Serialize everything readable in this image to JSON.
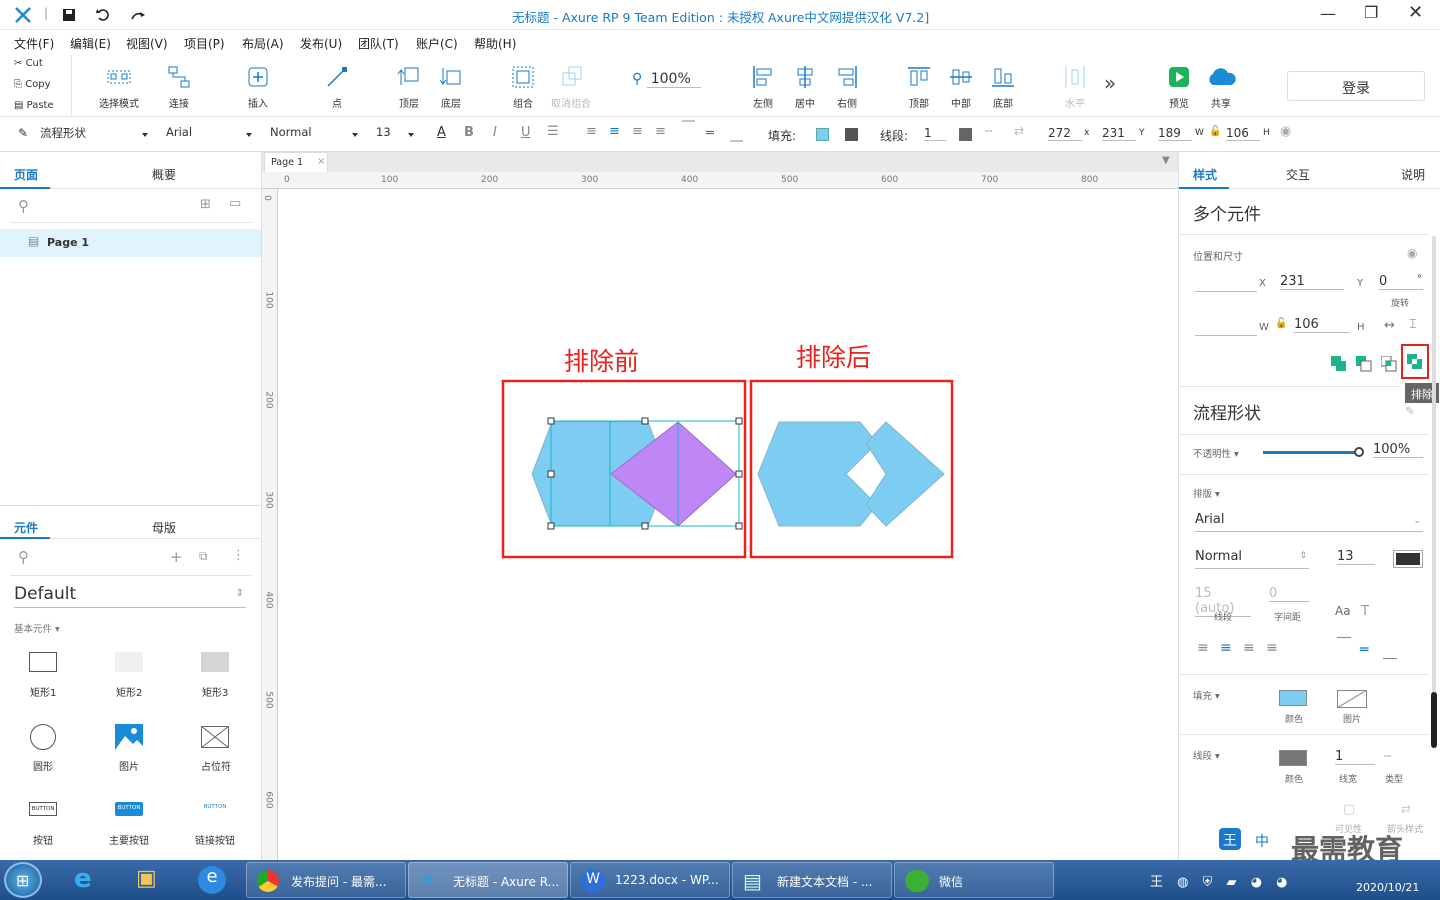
{
  "window": {
    "title": "无标题 - Axure RP 9 Team Edition : ",
    "title_status": "未授权",
    "title_extra": "Axure中文网提供汉化 V7.2]"
  },
  "menu": [
    "文件(F)",
    "编辑(E)",
    "视图(V)",
    "项目(P)",
    "布局(A)",
    "发布(U)",
    "团队(T)",
    "账户(C)",
    "帮助(H)"
  ],
  "clipboard": {
    "cut": "Cut",
    "copy": "Copy",
    "paste": "Paste"
  },
  "toolbar": {
    "select_mode": "选择模式",
    "connect": "连接",
    "insert": "插入",
    "point": "点",
    "top_layer": "顶层",
    "bottom_layer": "底层",
    "group": "组合",
    "ungroup": "取消组合",
    "zoom": "100%",
    "left": "左侧",
    "center": "居中",
    "right": "右侧",
    "top": "顶部",
    "middle": "中部",
    "bottom": "底部",
    "horizontal": "水平",
    "more": "»",
    "preview": "预览",
    "share": "共享",
    "login": "登录"
  },
  "format": {
    "shape_style": "流程形状",
    "font": "Arial",
    "weight": "Normal",
    "size": "13",
    "fill_label": "填充:",
    "line_label": "线段:",
    "line_width": "1",
    "x": "272",
    "x_lbl": "x",
    "y": "231",
    "y_lbl": "Y",
    "w": "189",
    "w_lbl": "W",
    "h": "106",
    "h_lbl": "H"
  },
  "pages_panel": {
    "tab_pages": "页面",
    "tab_outline": "概要",
    "page1": "Page 1"
  },
  "lib_panel": {
    "tab_widgets": "元件",
    "tab_masters": "母版",
    "library": "Default",
    "category": "基本元件 ▾",
    "items": [
      "矩形1",
      "矩形2",
      "矩形3",
      "圆形",
      "图片",
      "占位符",
      "按钮",
      "主要按钮",
      "链接按钮"
    ],
    "button_text": [
      "BUTTON",
      "BUTTON",
      "BUTTON"
    ]
  },
  "canvas": {
    "tab": "Page 1",
    "ruler_h": [
      "0",
      "100",
      "200",
      "300",
      "400",
      "500",
      "600",
      "700",
      "800"
    ],
    "ruler_v": [
      "0",
      "100",
      "200",
      "300",
      "400",
      "500",
      "600"
    ],
    "label_before": "排除前",
    "label_after": "排除后",
    "colors": {
      "shape_blue": "#7dcdf2",
      "shape_purple": "#bf86f6",
      "annotation_red": "#e8221d",
      "accent": "#1a7ac9"
    }
  },
  "right_panel": {
    "tab_style": "样式",
    "tab_interact": "交互",
    "tab_notes": "说明",
    "title": "多个元件",
    "pos_size": "位置和尺寸",
    "x_lbl": "X",
    "x_val": "231",
    "y_lbl": "Y",
    "y_val": "0",
    "deg": "°",
    "rotate": "旋转",
    "w_lbl": "W",
    "w_val": "106",
    "h_lbl": "H",
    "tooltip": "排除",
    "shape_title": "流程形状",
    "opacity_lbl": "不透明性 ▾",
    "opacity_val": "100%",
    "typography": "排版 ▾",
    "font": "Arial",
    "weight": "Normal",
    "size": "13",
    "line_spacing": "15 (auto)",
    "char_spacing": "0",
    "line_spacing_lbl": "线段",
    "char_spacing_lbl": "字间距",
    "fill": "填充 ▾",
    "color": "颜色",
    "image": "图片",
    "border": "线段 ▾",
    "border_color": "颜色",
    "border_width": "1",
    "border_width_lbl": "线宽",
    "border_type": "类型",
    "visible": "可见性",
    "arrow": "箭头样式"
  },
  "taskbar": {
    "tasks": [
      "发布提问 - 最需...",
      "无标题 - Axure R...",
      "1223.docx - WP...",
      "新建文本文档 - ...",
      "微信"
    ],
    "time": "2020/10/21",
    "watermark": "最需教育",
    "ime": "中"
  }
}
